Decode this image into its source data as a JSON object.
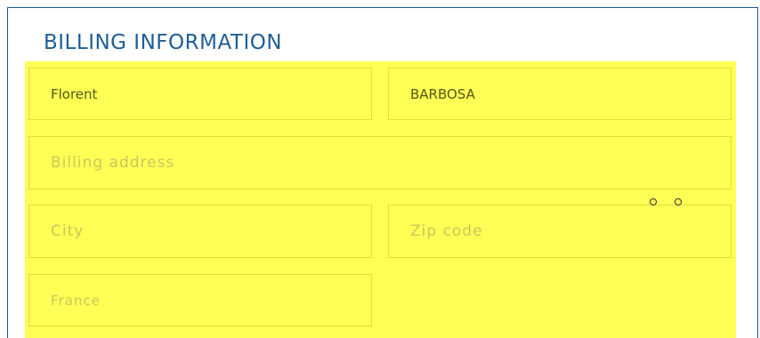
{
  "section": {
    "title": "BILLING INFORMATION"
  },
  "form": {
    "first_name": {
      "value": "Florent"
    },
    "last_name": {
      "value": "BARBOSA"
    },
    "billing_address": {
      "value": "",
      "placeholder": "Billing address"
    },
    "city": {
      "value": "",
      "placeholder": "City"
    },
    "zip_code": {
      "value": "",
      "placeholder": "Zip code"
    },
    "country": {
      "value": "France"
    }
  },
  "colors": {
    "title": "#1f5e96",
    "card_border": "#1a5a8c",
    "form_highlight": "#ffff55",
    "field_border": "#e0dc3c",
    "filled_text": "#555a16",
    "placeholder_text": "#c8c85c"
  },
  "icons": [
    "loading-dot-icon",
    "loading-dot-icon"
  ]
}
